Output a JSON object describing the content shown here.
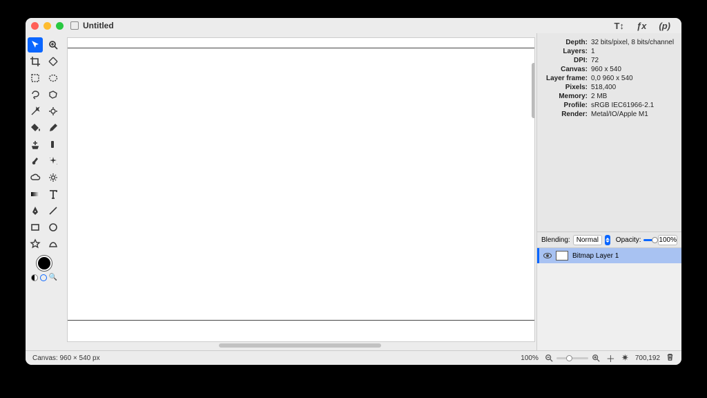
{
  "title": "Untitled",
  "header_buttons": {
    "t": "T↕",
    "fx": "ƒx",
    "p": "(p)"
  },
  "info": {
    "depth_label": "Depth:",
    "depth": "32 bits/pixel, 8 bits/channel",
    "layers_label": "Layers:",
    "layers": "1",
    "dpi_label": "DPI:",
    "dpi": "72",
    "canvas_label": "Canvas:",
    "canvas": "960 x 540",
    "frame_label": "Layer frame:",
    "frame": "0,0 960 x 540",
    "pixels_label": "Pixels:",
    "pixels": "518,400",
    "memory_label": "Memory:",
    "memory": "2 MB",
    "profile_label": "Profile:",
    "profile": "sRGB IEC61966-2.1",
    "render_label": "Render:",
    "render": "Metal/IO/Apple M1"
  },
  "blend": {
    "label": "Blending:",
    "mode": "Normal",
    "opacity_label": "Opacity:",
    "opacity": "100%"
  },
  "layer1": "Bitmap Layer 1",
  "status": {
    "canvas": "Canvas: 960 × 540 px",
    "zoom": "100%",
    "coords": "700,192"
  }
}
